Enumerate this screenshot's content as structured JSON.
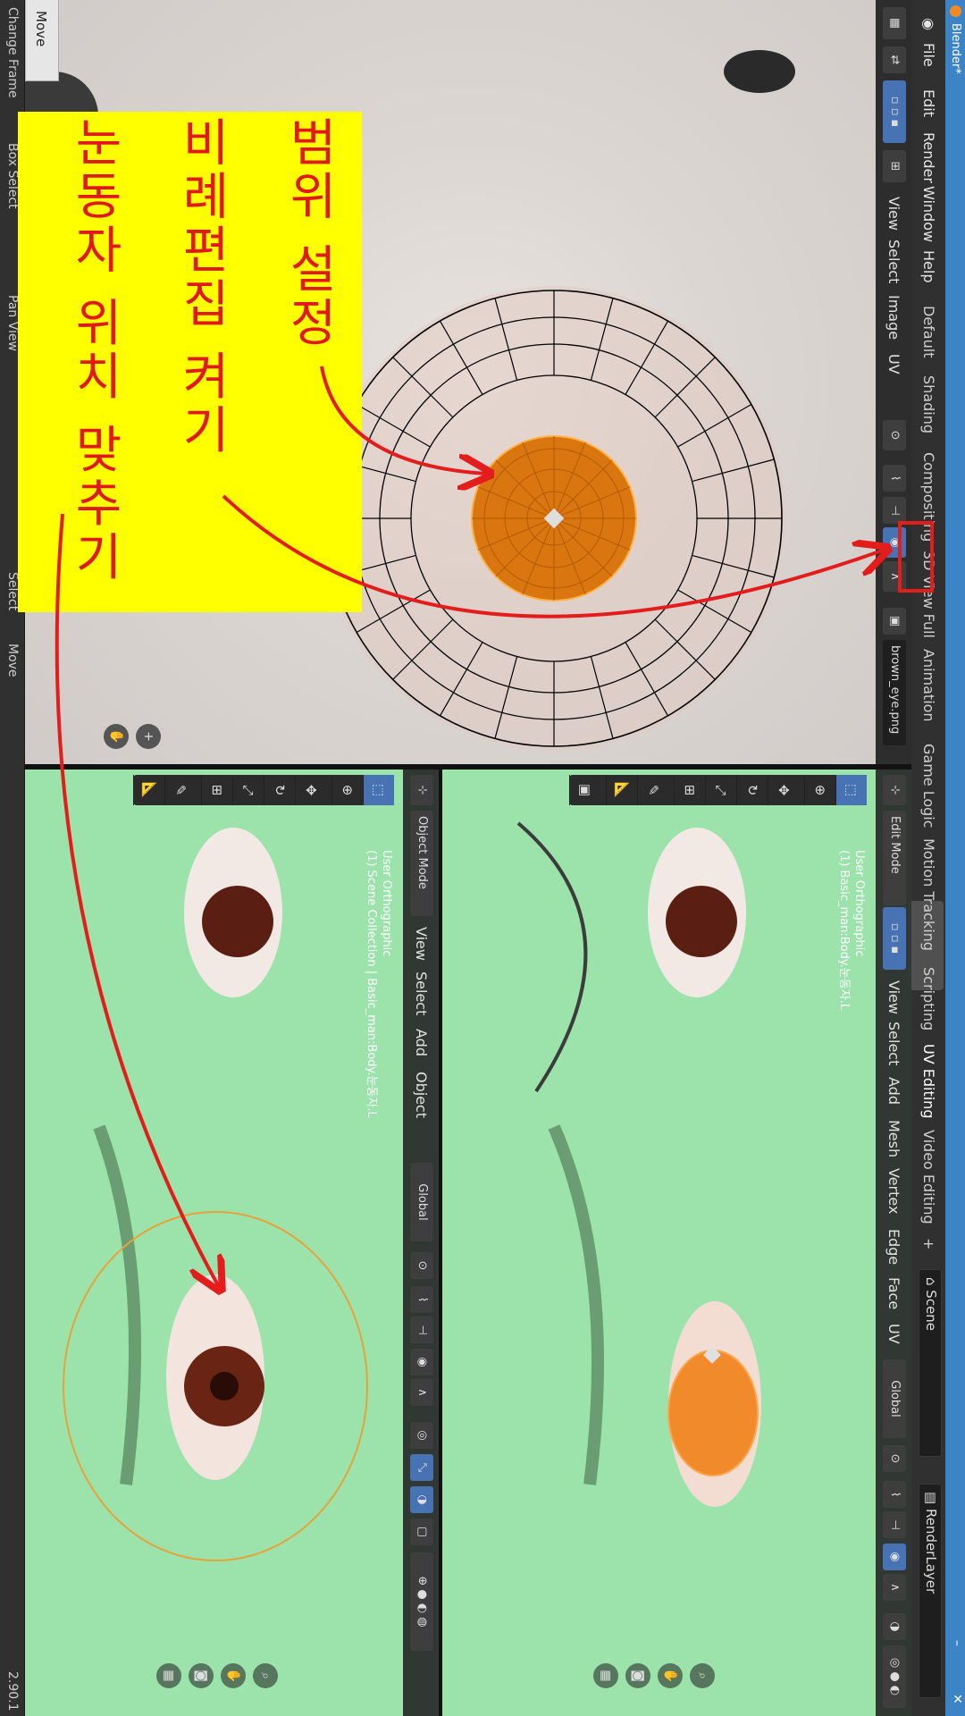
{
  "app": {
    "title": "Blender*",
    "version": "2.90.1"
  },
  "menus": [
    "File",
    "Edit",
    "Render",
    "Window",
    "Help"
  ],
  "workspaces": [
    "Default",
    "Shading",
    "Compositing",
    "3D View Full",
    "Animation",
    "Game Logic",
    "Motion Tracking",
    "Scripting",
    "UV Editing",
    "Video Editing"
  ],
  "active_workspace": "UV Editing",
  "add_workspace": "+",
  "scene": {
    "name": "Scene",
    "view_layer": "RenderLayer"
  },
  "uv_editor": {
    "menus": [
      "View",
      "Select",
      "Image",
      "UV"
    ],
    "image_name": "brown_eye.png"
  },
  "viewport_top": {
    "mode": "Edit Mode",
    "menus": [
      "View",
      "Select",
      "Add",
      "Mesh",
      "Vertex",
      "Edge",
      "Face",
      "UV"
    ],
    "orientation": "Global",
    "info_line1": "User Orthographic",
    "info_line2": "(1) Basic_man:Body.눈동자.L"
  },
  "viewport_bottom": {
    "mode": "Object Mode",
    "menus": [
      "View",
      "Select",
      "Add",
      "Object"
    ],
    "orientation": "Global",
    "info_line1": "User Orthographic",
    "info_line2": "(1) Scene Collection | Basic_man:Body.눈동자.L"
  },
  "operator_panel": {
    "title": "Move"
  },
  "status_bar": [
    "Change Frame",
    "Box Select",
    "Pan View",
    "Select",
    "Move"
  ],
  "annotation": {
    "lines": [
      "범위 설정",
      "비례편집 켜기",
      "눈동자 위치 맞추기"
    ],
    "color": "#e01a1a",
    "background": "#ffff00"
  },
  "colors": {
    "accent": "#4772b3",
    "titlebar": "#3d84c7",
    "selection": "#e3821a",
    "viewport_bg": "#9be3ab"
  },
  "icons": {
    "blender": "blender-logo-icon",
    "proportional": "proportional-editing-icon",
    "falloff": "falloff-curve-icon"
  }
}
